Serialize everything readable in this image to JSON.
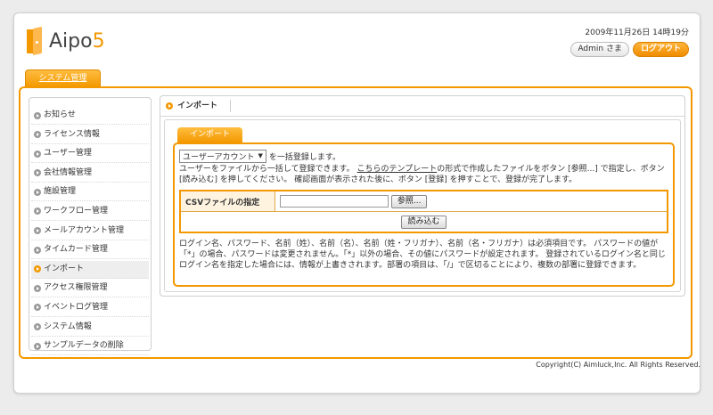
{
  "header": {
    "logo_text_main": "Aipo",
    "logo_text_num": "5",
    "datetime": "2009年11月26日 14時19分",
    "user_label": "Admin さま",
    "logout_label": "ログアウト"
  },
  "nav": {
    "system_tab": "システム管理"
  },
  "sidebar": {
    "items": [
      {
        "label": "お知らせ"
      },
      {
        "label": "ライセンス情報"
      },
      {
        "label": "ユーザー管理"
      },
      {
        "label": "会社情報管理"
      },
      {
        "label": "施設管理"
      },
      {
        "label": "ワークフロー管理"
      },
      {
        "label": "メールアカウント管理"
      },
      {
        "label": "タイムカード管理"
      },
      {
        "label": "インポート"
      },
      {
        "label": "アクセス権限管理"
      },
      {
        "label": "イベントログ管理"
      },
      {
        "label": "システム情報"
      },
      {
        "label": "サンプルデータの削除"
      }
    ],
    "active_index": 8
  },
  "content": {
    "title": "インポート",
    "tab_label": "インポート",
    "select_value": "ユーザーアカウント",
    "select_suffix": "を一括登録します。",
    "desc_part1": "ユーザーをファイルから一括して登録できます。",
    "desc_link": "こちらのテンプレート",
    "desc_part2": "の形式で作成したファイルをボタン [参照...] で指定し、ボタン [読み込む] を押してください。 確認画面が表示された後に、ボタン [登録] を押すことで、登録が完了します。",
    "csv_label": "CSVファイルの指定",
    "browse_button": "参照...",
    "load_button": "読み込む",
    "note": "ログイン名、パスワード、名前（姓）、名前（名）、名前（姓・フリガナ）、名前（名・フリガナ）は必須項目です。 パスワードの値が「*」の場合、パスワードは変更されません。「*」以外の場合、その値にパスワードが設定されます。 登録されているログイン名と同じログイン名を指定した場合には、情報が上書きされます。部署の項目は、「/」で区切ることにより、複数の部署に登録できます。"
  },
  "footer": {
    "copyright": "Copyright(C) Aimluck,Inc. All Rights Reserved."
  }
}
